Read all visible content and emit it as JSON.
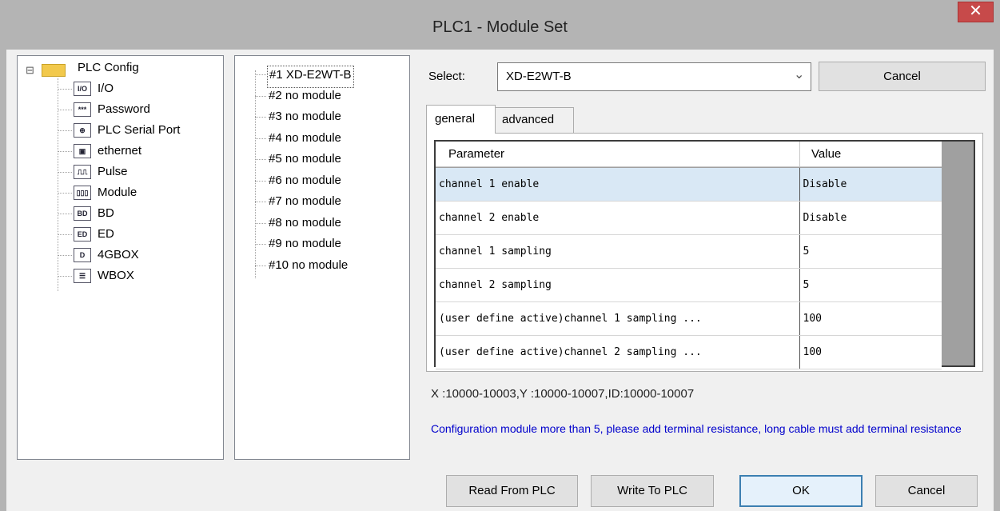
{
  "window": {
    "title": "PLC1 - Module  Set",
    "close_glyph": "✕"
  },
  "config_tree": {
    "root": {
      "expander": "⊟",
      "label": "PLC Config"
    },
    "items": [
      {
        "icon": "I/O",
        "label": "I/O"
      },
      {
        "icon": "***",
        "label": "Password"
      },
      {
        "icon": "⊕",
        "label": "PLC Serial Port"
      },
      {
        "icon": "▣",
        "label": "ethernet"
      },
      {
        "icon": "⎍⎍",
        "label": "Pulse"
      },
      {
        "icon": "▯▯▯",
        "label": "Module"
      },
      {
        "icon": "BD",
        "label": "BD"
      },
      {
        "icon": "ED",
        "label": "ED"
      },
      {
        "icon": "D",
        "label": "4GBOX"
      },
      {
        "icon": "☰",
        "label": "WBOX"
      }
    ]
  },
  "module_list": {
    "items": [
      "#1 XD-E2WT-B",
      "#2 no module",
      "#3 no module",
      "#4 no module",
      "#5 no module",
      "#6 no module",
      "#7 no module",
      "#8 no module",
      "#9 no module",
      "#10 no module"
    ],
    "selected_index": 0
  },
  "select": {
    "label": "Select:",
    "value": "XD-E2WT-B",
    "arrow": "⌄"
  },
  "top_cancel_label": "Cancel",
  "tabs": [
    {
      "label": "general",
      "active": true
    },
    {
      "label": "advanced",
      "active": false
    }
  ],
  "param_table": {
    "headers": [
      "Parameter",
      "Value"
    ],
    "rows": [
      {
        "param": "channel 1 enable",
        "value": "Disable"
      },
      {
        "param": "channel 2 enable",
        "value": "Disable"
      },
      {
        "param": "channel 1 sampling",
        "value": "5"
      },
      {
        "param": "channel 2 sampling",
        "value": "5"
      },
      {
        "param": "(user define active)channel 1 sampling ...",
        "value": "100"
      },
      {
        "param": "(user define active)channel 2 sampling ...",
        "value": "100"
      }
    ],
    "selected_row": 0
  },
  "address_info": "X :10000-10003,Y :10000-10007,ID:10000-10007",
  "note": "Configuration module more than 5, please add terminal resistance, long cable must add terminal resistance",
  "buttons": {
    "read": "Read From PLC",
    "write": "Write To PLC",
    "ok": "OK",
    "cancel": "Cancel"
  },
  "colors": {
    "note_text": "#0000cc",
    "selected_row": "#d9e8f5",
    "close_button": "#c74a4a"
  }
}
